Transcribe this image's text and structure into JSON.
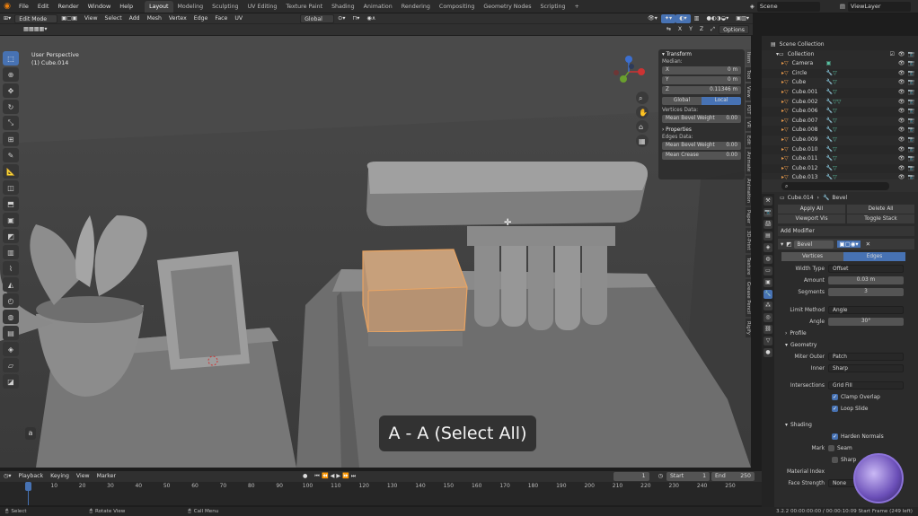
{
  "topbar": {
    "menus": [
      "File",
      "Edit",
      "Render",
      "Window",
      "Help"
    ],
    "workspaces": [
      "Layout",
      "Modeling",
      "Sculpting",
      "UV Editing",
      "Texture Paint",
      "Shading",
      "Animation",
      "Rendering",
      "Compositing",
      "Geometry Nodes",
      "Scripting"
    ],
    "add_tab": "+",
    "scene_label": "Scene",
    "viewlayer_label": "ViewLayer"
  },
  "header3d": {
    "mode": "Edit Mode",
    "menus": [
      "View",
      "Select",
      "Add",
      "Mesh",
      "Vertex",
      "Edge",
      "Face",
      "UV"
    ],
    "orientation": "Global",
    "axes": [
      "X",
      "Y",
      "Z"
    ],
    "options": "Options"
  },
  "viewport": {
    "perspective": "User Perspective",
    "object": "(1) Cube.014",
    "subtitle": "A - A (Select All)"
  },
  "npanel": {
    "title": "Transform",
    "median_label": "Median:",
    "x_label": "X",
    "x_value": "0 m",
    "y_label": "Y",
    "y_value": "0 m",
    "z_label": "Z",
    "z_value": "0.11346 m",
    "global": "Global",
    "local": "Local",
    "vertices_data": "Vertices Data:",
    "mean_bevel_weight_label": "Mean Bevel Weight",
    "mean_bevel_weight_value": "0.00",
    "properties": "Properties",
    "edges_data": "Edges Data:",
    "edge_bevel_weight_label": "Mean Bevel Weight",
    "edge_bevel_weight_value": "0.00",
    "mean_crease_label": "Mean Crease",
    "mean_crease_value": "0.00"
  },
  "sidetabs": [
    "Item",
    "Tool",
    "View",
    "PDT",
    "VR",
    "Edit",
    "Animate",
    "Animation",
    "Paper",
    "3D-Print",
    "Texture",
    "Grease Pencil",
    "Rigify"
  ],
  "outliner": {
    "scene_collection": "Scene Collection",
    "collection": "Collection",
    "items": [
      "Camera",
      "Circle",
      "Cube",
      "Cube.001",
      "Cube.002",
      "Cube.006",
      "Cube.007",
      "Cube.008",
      "Cube.009",
      "Cube.010",
      "Cube.011",
      "Cube.012",
      "Cube.013"
    ]
  },
  "properties": {
    "object": "Cube.014",
    "modifier_crumb": "Bevel",
    "apply_all": "Apply All",
    "delete_all": "Delete All",
    "viewport_vis": "Viewport Vis",
    "toggle_stack": "Toggle Stack",
    "add_modifier": "Add Modifier",
    "modifier_name": "Bevel",
    "vertices_tab": "Vertices",
    "edges_tab": "Edges",
    "width_type_label": "Width Type",
    "width_type": "Offset",
    "amount_label": "Amount",
    "amount": "0.03 m",
    "segments_label": "Segments",
    "segments": "3",
    "limit_method_label": "Limit Method",
    "limit_method": "Angle",
    "angle_label": "Angle",
    "angle": "30°",
    "profile": "Profile",
    "geometry": "Geometry",
    "miter_outer_label": "Miter Outer",
    "miter_outer": "Patch",
    "inner_label": "Inner",
    "inner": "Sharp",
    "intersections_label": "Intersections",
    "intersections": "Grid Fill",
    "clamp_overlap": "Clamp Overlap",
    "loop_slide": "Loop Slide",
    "shading": "Shading",
    "harden_normals": "Harden Normals",
    "mark_label": "Mark",
    "seam": "Seam",
    "sharp": "Sharp",
    "material_index_label": "Material Index",
    "face_strength_label": "Face Strength",
    "face_strength": "None"
  },
  "timeline": {
    "menus": [
      "Playback",
      "Keying",
      "View",
      "Marker"
    ],
    "current_frame": "1",
    "start_label": "Start",
    "start": "1",
    "end_label": "End",
    "end": "250",
    "ticks": [
      "1",
      "10",
      "20",
      "30",
      "40",
      "50",
      "60",
      "70",
      "80",
      "90",
      "100",
      "110",
      "120",
      "130",
      "140",
      "150",
      "160",
      "170",
      "180",
      "190",
      "200",
      "210",
      "220",
      "230",
      "240",
      "250"
    ]
  },
  "statusbar": {
    "select": "Select",
    "rotate": "Rotate View",
    "callmenu": "Call Menu",
    "version": "3.2.2  00:00:00:00 / 00:00:10:09  Start Frame (249 left)"
  },
  "colors": {
    "accent": "#4772b3",
    "selection": "#e9a462",
    "viewport_bg": "#4d4d4d"
  }
}
